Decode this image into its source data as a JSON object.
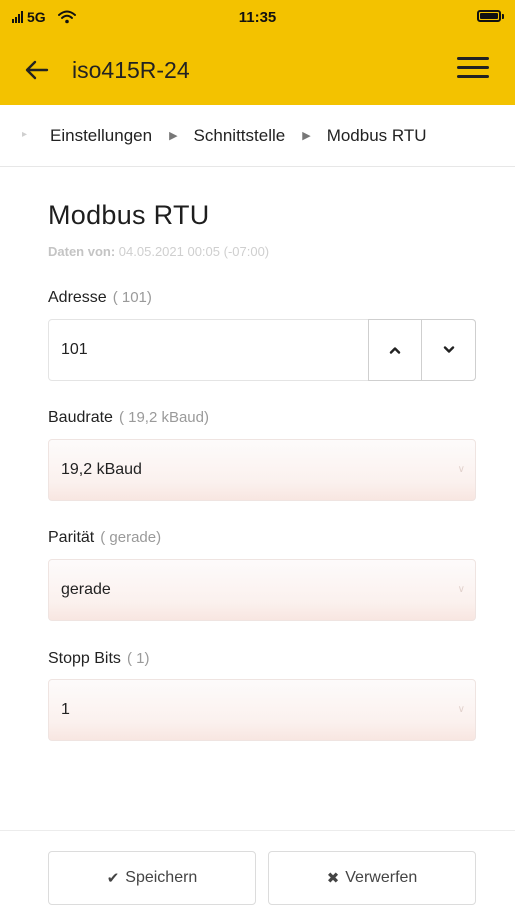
{
  "status_bar": {
    "carrier": "5G",
    "time": "11:35"
  },
  "app_bar": {
    "title": "iso415R-24",
    "back_icon": "arrow-left-icon",
    "menu_icon": "hamburger-menu-icon",
    "background": "#f3c200"
  },
  "breadcrumb": {
    "items": [
      "Einstellungen",
      "Schnittstelle",
      "Modbus RTU"
    ]
  },
  "page": {
    "title": "Modbus RTU",
    "data_label": "Daten von:",
    "data_timestamp": "04.05.2021 00:05 (-07:00)"
  },
  "form": {
    "address": {
      "label": "Adresse",
      "hint": "( 101)",
      "value": "101"
    },
    "baudrate": {
      "label": "Baudrate",
      "hint": "( 19,2 kBaud)",
      "value": "19,2 kBaud"
    },
    "parity": {
      "label": "Parität",
      "hint": "( gerade)",
      "value": "gerade"
    },
    "stop_bits": {
      "label": "Stopp Bits",
      "hint": "( 1)",
      "value": "1"
    }
  },
  "footer": {
    "save_label": "Speichern",
    "discard_label": "Verwerfen"
  }
}
